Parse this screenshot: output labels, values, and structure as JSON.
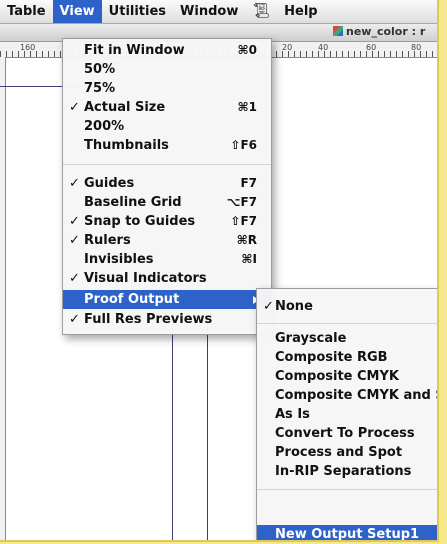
{
  "menubar": {
    "items": [
      "Table",
      "View",
      "Utilities",
      "Window",
      "Help"
    ],
    "active_index": 1,
    "script_icon": "scroll-icon"
  },
  "document": {
    "title": "new_color : r",
    "ruler_labels": [
      "160",
      "20",
      "40",
      "60",
      "80"
    ]
  },
  "view_menu": {
    "items": [
      {
        "label": "Fit in Window",
        "shortcut": "⌘0",
        "checked": false
      },
      {
        "label": "50%",
        "shortcut": "",
        "checked": false
      },
      {
        "label": "75%",
        "shortcut": "",
        "checked": false
      },
      {
        "label": "Actual Size",
        "shortcut": "⌘1",
        "checked": true
      },
      {
        "label": "200%",
        "shortcut": "",
        "checked": false
      },
      {
        "label": "Thumbnails",
        "shortcut": "⇧F6",
        "checked": false
      },
      {
        "label": "Guides",
        "shortcut": "F7",
        "checked": true
      },
      {
        "label": "Baseline Grid",
        "shortcut": "⌥F7",
        "checked": false
      },
      {
        "label": "Snap to Guides",
        "shortcut": "⇧F7",
        "checked": true
      },
      {
        "label": "Rulers",
        "shortcut": "⌘R",
        "checked": true
      },
      {
        "label": "Invisibles",
        "shortcut": "⌘I",
        "checked": false
      },
      {
        "label": "Visual Indicators",
        "shortcut": "",
        "checked": true
      },
      {
        "label": "Proof Output",
        "shortcut": "",
        "checked": false,
        "submenu": true,
        "highlighted": true
      },
      {
        "label": "Full Res Previews",
        "shortcut": "",
        "checked": true
      }
    ]
  },
  "proof_submenu": {
    "items": [
      {
        "label": "None",
        "checked": true
      },
      {
        "label": "Grayscale",
        "checked": false
      },
      {
        "label": "Composite RGB",
        "checked": false
      },
      {
        "label": "Composite CMYK",
        "checked": false
      },
      {
        "label": "Composite CMYK and Spot",
        "checked": false
      },
      {
        "label": "As Is",
        "checked": false
      },
      {
        "label": "Convert To Process",
        "checked": false
      },
      {
        "label": "Process and Spot",
        "checked": false
      },
      {
        "label": "In-RIP Separations",
        "checked": false
      },
      {
        "label": "New Output Setup1",
        "checked": false,
        "highlighted": true
      }
    ]
  },
  "colors": {
    "highlight": "#2d63c8",
    "frame_background": "#f5e98a",
    "guide": "#3c3f7a"
  },
  "check_mark": "✓"
}
